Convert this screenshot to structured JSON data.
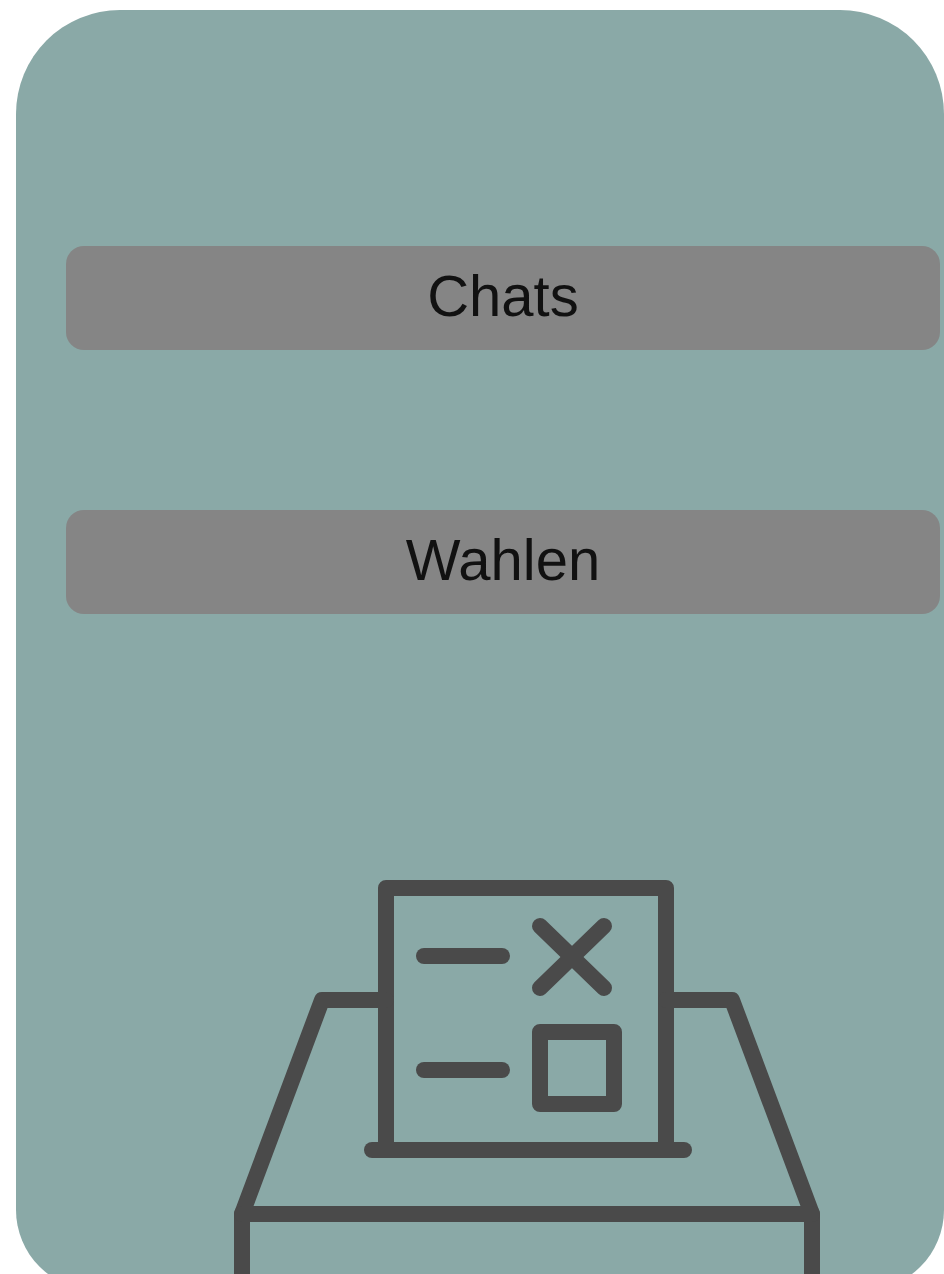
{
  "menu": [
    {
      "label": "Chats"
    },
    {
      "label": "Wahlen"
    }
  ]
}
